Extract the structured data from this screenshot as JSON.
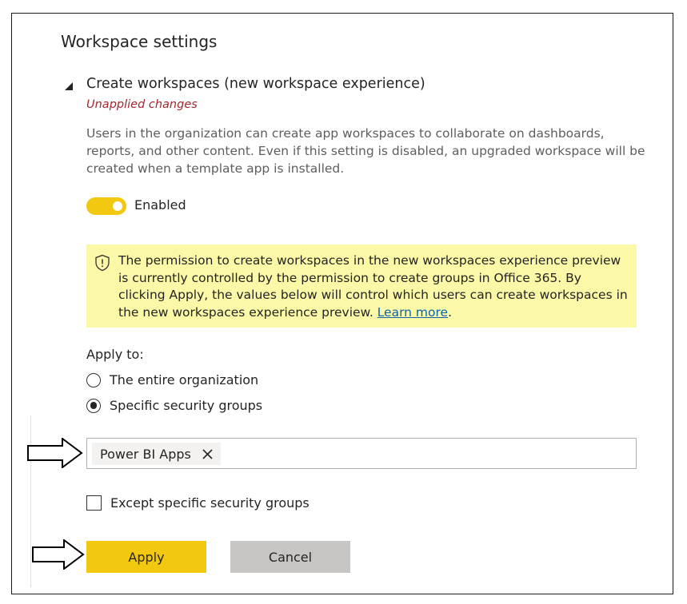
{
  "panel": {
    "title": "Workspace settings"
  },
  "section": {
    "title": "Create workspaces (new workspace experience)",
    "collapse_icon": "triangle-down-icon",
    "status": "Unapplied changes",
    "description": "Users in the organization can create app workspaces to collaborate on dashboards, reports, and other content. Even if this setting is disabled, an upgraded workspace will be created when a template app is installed.",
    "toggle": {
      "label": "Enabled",
      "on": true
    }
  },
  "warning": {
    "icon": "shield-icon",
    "text": "The permission to create workspaces in the new workspaces experience preview is currently controlled by the permission to create groups in Office 365. By clicking Apply, the values below will control which users can create workspaces in the new workspaces experience preview. ",
    "link_text": "Learn more",
    "trailing": "."
  },
  "apply_to": {
    "label": "Apply to:",
    "options": [
      {
        "label": "The entire organization",
        "selected": false
      },
      {
        "label": "Specific security groups",
        "selected": true
      }
    ]
  },
  "groups_input": {
    "chips": [
      {
        "label": "Power BI Apps",
        "remove_icon": "close-icon"
      }
    ]
  },
  "except_groups": {
    "label": "Except specific security groups",
    "checked": false
  },
  "buttons": {
    "apply": "Apply",
    "cancel": "Cancel"
  },
  "annotations": {
    "arrow_icon": "arrow-right-icon"
  },
  "colors": {
    "accent": "#f2c811",
    "warning_bg": "#fbf8a8",
    "error_text": "#a4262c",
    "link": "#0f62ac",
    "cancel_bg": "#c8c6c4"
  }
}
